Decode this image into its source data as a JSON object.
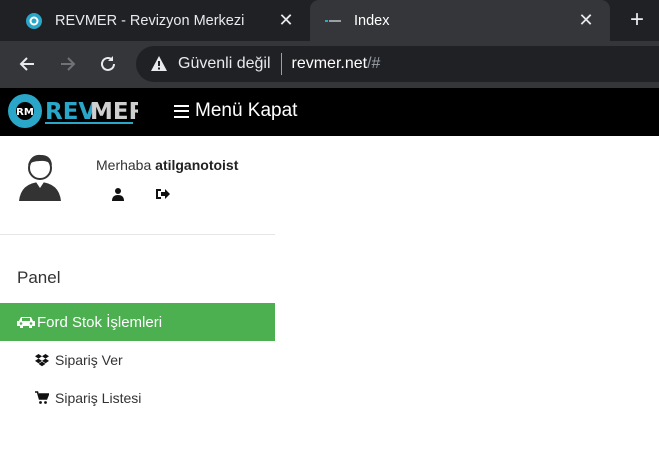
{
  "browser": {
    "tabs": [
      {
        "title": "REVMER - Revizyon Merkezi",
        "favicon": "revmer-logo-icon",
        "active": false
      },
      {
        "title": "Index",
        "favicon": "page-favicon-icon",
        "active": true
      }
    ],
    "new_tab": "+",
    "security_label": "Güvenli değil",
    "url_host": "revmer.net",
    "url_path": "/#"
  },
  "app": {
    "logo_text": "REVMER",
    "logo_badge": "RM",
    "menu_toggle_label": "Menü Kapat"
  },
  "user": {
    "greeting": "Merhaba",
    "username": "atilganotoist"
  },
  "sidebar": {
    "panel_title": "Panel",
    "active_item": "Ford Stok İşlemleri",
    "sub_items": [
      {
        "label": "Sipariş Ver",
        "icon": "dropbox-icon"
      },
      {
        "label": "Sipariş Listesi",
        "icon": "cart-icon"
      }
    ]
  },
  "colors": {
    "active_menu": "#4caf50",
    "appbar": "#000000",
    "logo_accent": "#2aa6c9"
  }
}
